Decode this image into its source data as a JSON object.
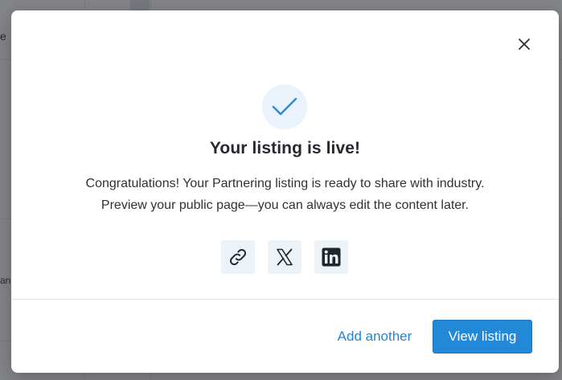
{
  "background": {
    "partial_label_top": "e",
    "partial_label_mid": "an"
  },
  "dialog": {
    "close_icon": "close-icon",
    "status_icon": "checkmark-icon",
    "title": "Your listing is live!",
    "description_line1": "Congratulations! Your Partnering listing is ready to share with industry.",
    "description_line2": "Preview your public page—you can always edit the content later.",
    "share": [
      {
        "icon": "link-icon"
      },
      {
        "icon": "x-twitter-icon"
      },
      {
        "icon": "linkedin-icon"
      }
    ],
    "secondary_action": "Add another",
    "primary_action": "View listing"
  },
  "colors": {
    "accent": "#2288d8",
    "link": "#1f86d2",
    "icon_bg": "#ebf3f9",
    "title": "#25282c"
  }
}
